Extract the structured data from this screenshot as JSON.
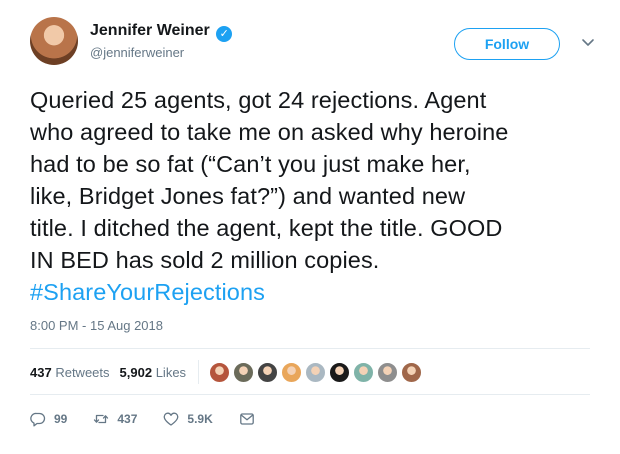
{
  "author": {
    "display_name": "Jennifer Weiner",
    "handle": "@jenniferweiner",
    "verified_glyph": "✓",
    "verified_icon": "verified-badge-icon",
    "avatar": "author-avatar"
  },
  "follow": {
    "label": "Follow"
  },
  "menu": {
    "icon": "chevron-down-icon"
  },
  "tweet": {
    "lines": [
      "Queried 25 agents, got 24 rejections. Agent",
      "who agreed to take me on asked why heroine",
      "had to be so fat (“Can’t you just make her,",
      "like, Bridget Jones fat?”) and wanted new",
      "title. I ditched the agent, kept the title. GOOD",
      "IN BED has sold 2 million copies."
    ],
    "hashtag": "#ShareYourRejections",
    "timestamp": "8:00 PM - 15 Aug 2018"
  },
  "stats": {
    "retweets_count": "437",
    "retweets_label": "Retweets",
    "likes_count": "5,902",
    "likes_label": "Likes"
  },
  "likers": [
    {
      "color": "#b5553c"
    },
    {
      "color": "#6b6b5a"
    },
    {
      "color": "#444444"
    },
    {
      "color": "#e9a65a"
    },
    {
      "color": "#aab8c2"
    },
    {
      "color": "#1a1a1a"
    },
    {
      "color": "#7fb3a8"
    },
    {
      "color": "#8e8e8e"
    },
    {
      "color": "#a0674a"
    }
  ],
  "actions": {
    "reply": {
      "icon": "reply-icon",
      "count": "99"
    },
    "retweet": {
      "icon": "retweet-icon",
      "count": "437"
    },
    "like": {
      "icon": "heart-icon",
      "count": "5.9K"
    },
    "message": {
      "icon": "direct-message-icon"
    }
  },
  "colors": {
    "accent": "#1da1f2",
    "muted": "#657786",
    "text": "#14171a",
    "divider": "#e6ecf0"
  }
}
